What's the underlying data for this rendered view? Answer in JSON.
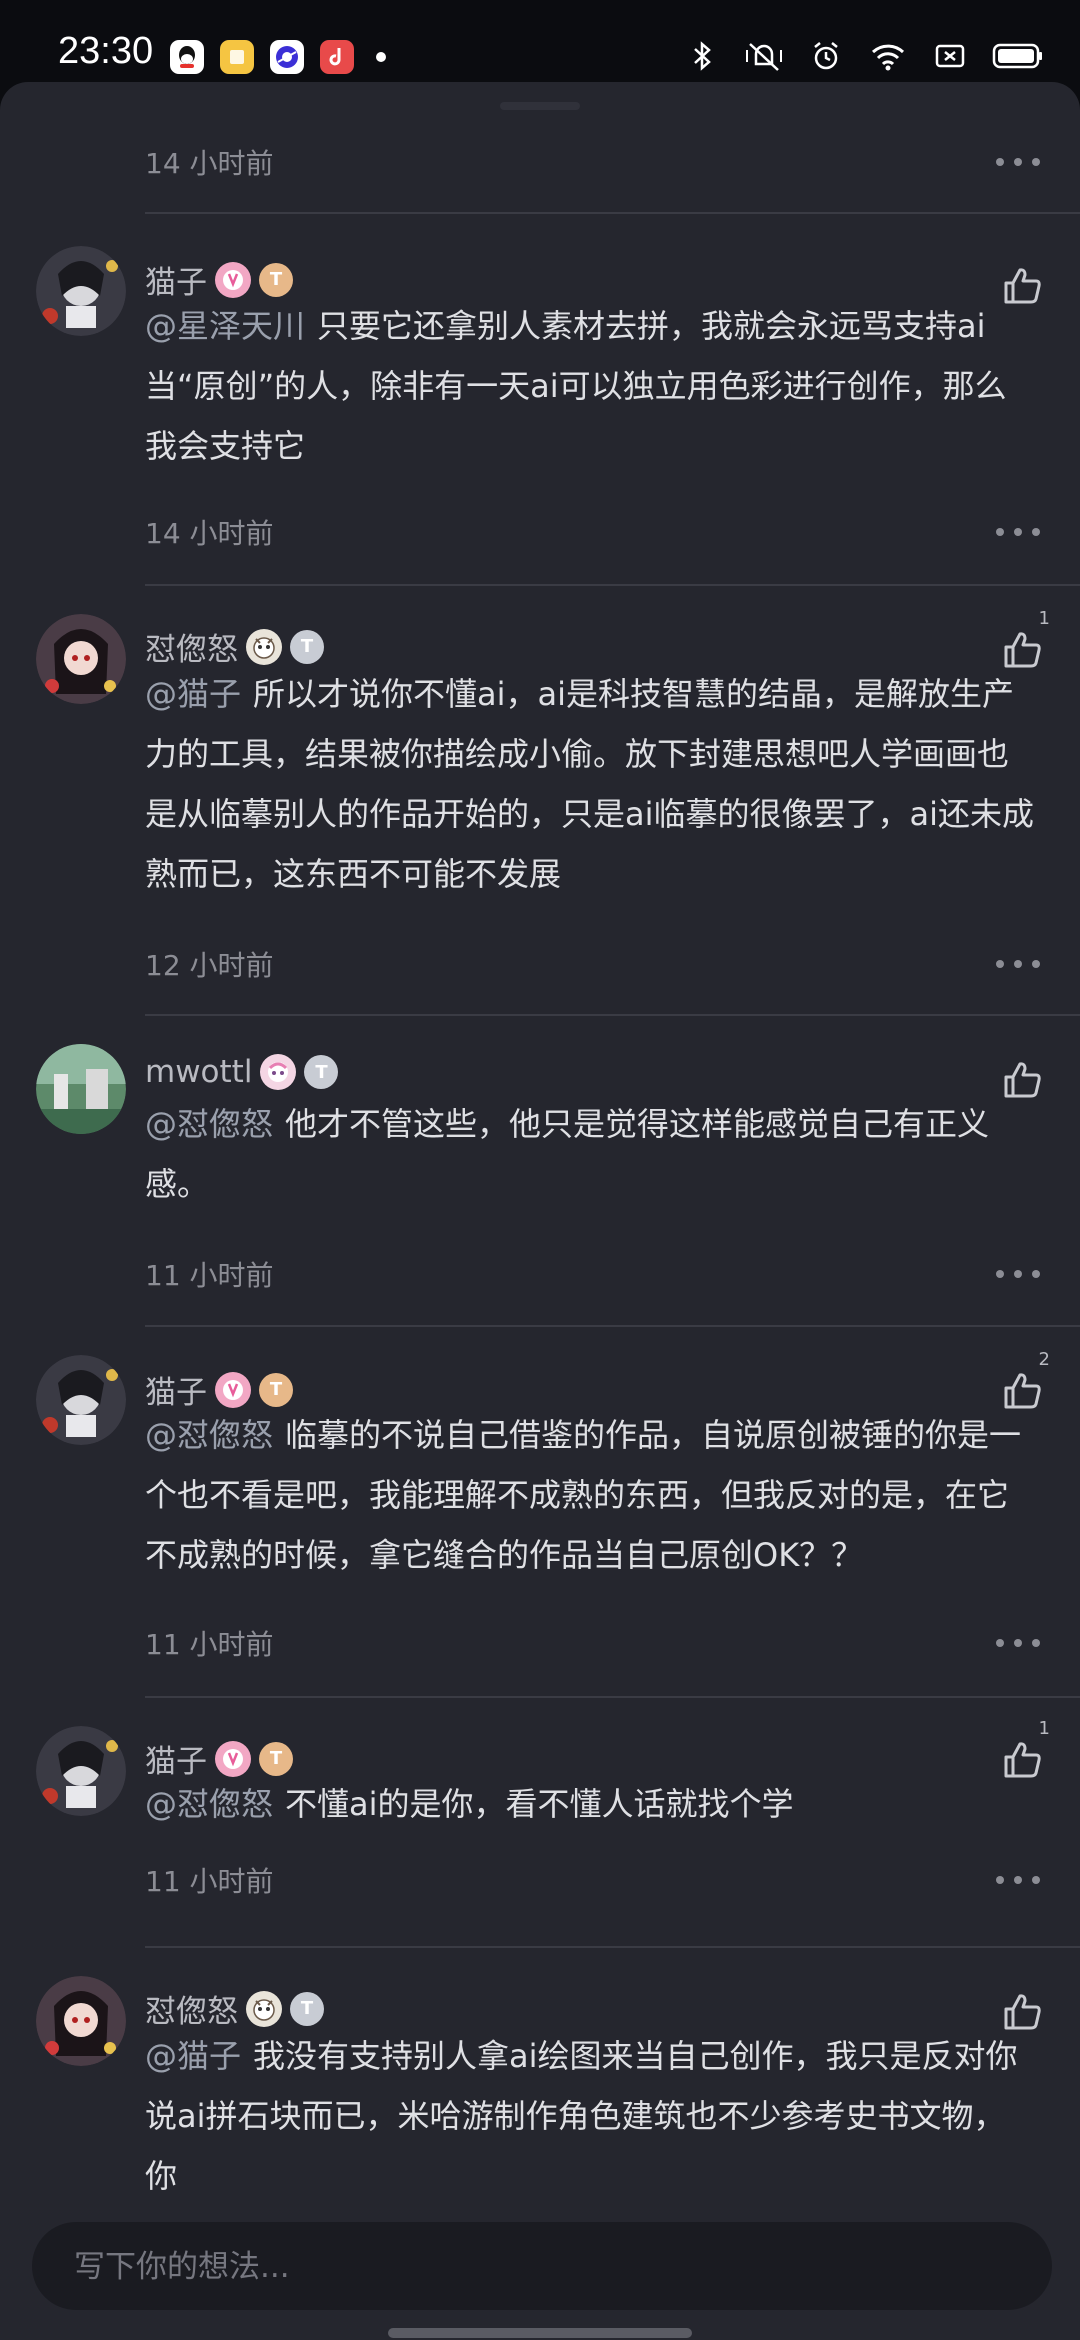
{
  "status_bar": {
    "time": "23:30",
    "app_icons": [
      "qq-icon",
      "notes-icon",
      "browser-icon",
      "music-icon"
    ],
    "system_icons": [
      "bluetooth-icon",
      "vibrate-mute-icon",
      "alarm-icon",
      "wifi-icon",
      "screen-cast-icon",
      "battery-icon"
    ]
  },
  "comments": [
    {
      "username": "",
      "mention": "",
      "text": "",
      "timestamp": "14 小时前",
      "like_count": ""
    },
    {
      "username": "猫子",
      "mention": "@星泽天川",
      "text": "只要它还拿别人素材去拼，我就会永远骂支持ai当“原创”的人，除非有一天ai可以独立用色彩进行创作，那么我会支持它",
      "timestamp": "14 小时前",
      "like_count": ""
    },
    {
      "username": "怼偬怒",
      "mention": "@猫子",
      "text": "所以才说你不懂ai，ai是科技智慧的结晶，是解放生产力的工具，结果被你描绘成小偷。放下封建思想吧人学画画也是从临摹别人的作品开始的，只是ai临摹的很像罢了，ai还未成熟而已，这东西不可能不发展",
      "timestamp": "12 小时前",
      "like_count": "1"
    },
    {
      "username": "mwottl",
      "mention": "@怼偬怒",
      "text": "他才不管这些，他只是觉得这样能感觉自己有正义感。",
      "timestamp": "11 小时前",
      "like_count": ""
    },
    {
      "username": "猫子",
      "mention": "@怼偬怒",
      "text": "临摹的不说自己借鉴的作品，自说原创被锤的你是一个也不看是吧，我能理解不成熟的东西，但我反对的是，在它不成熟的时候，拿它缝合的作品当自己原创OK？？",
      "timestamp": "11 小时前",
      "like_count": "2"
    },
    {
      "username": "猫子",
      "mention": "@怼偬怒",
      "text": "不懂ai的是你，看不懂人话就找个学",
      "timestamp": "11 小时前",
      "like_count": "1"
    },
    {
      "username": "怼偬怒",
      "mention": "@猫子",
      "text": "我没有支持别人拿ai绘图来当自己创作，我只是反对你说ai拼石块而已，米哈游制作角色建筑也不少参考史书文物，你",
      "timestamp": "",
      "like_count": ""
    }
  ],
  "input": {
    "placeholder": "写下你的想法..."
  },
  "colors": {
    "background": "#25262e",
    "username": "#b9bac1",
    "text": "#dfe0e4",
    "mention": "#9aa0ad",
    "timestamp": "#8c8d95"
  }
}
